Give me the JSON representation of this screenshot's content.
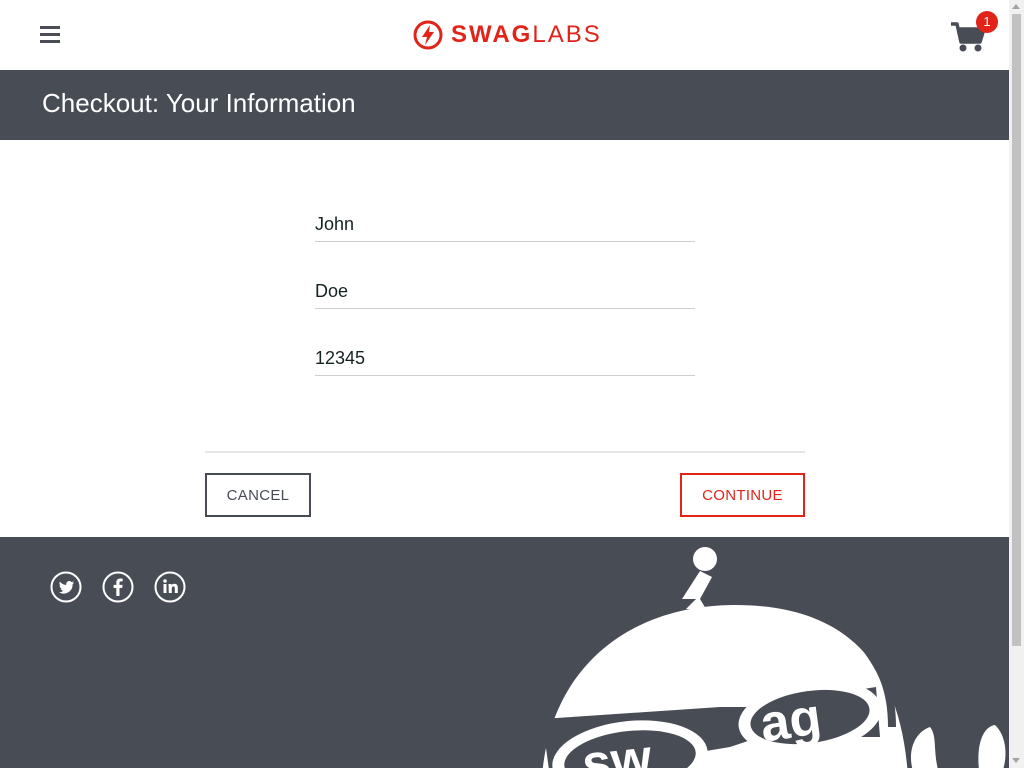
{
  "header": {
    "menu_icon": "hamburger-menu-icon",
    "logo": {
      "brand_bold": "SWAG",
      "brand_light": "LABS",
      "icon": "lightning-bolt-icon"
    },
    "cart": {
      "icon": "shopping-cart-icon",
      "badge_count": "1"
    }
  },
  "page": {
    "title": "Checkout: Your Information"
  },
  "form": {
    "first_name": {
      "value": "John"
    },
    "last_name": {
      "value": "Doe"
    },
    "postal_code": {
      "value": "12345"
    }
  },
  "actions": {
    "cancel_label": "CANCEL",
    "continue_label": "CONTINUE"
  },
  "footer": {
    "social": [
      "twitter-icon",
      "facebook-icon",
      "linkedin-icon"
    ],
    "mascot": "swag-bot-mascot"
  },
  "colors": {
    "brand_red": "#e2231a",
    "dark_gray": "#484c55"
  }
}
